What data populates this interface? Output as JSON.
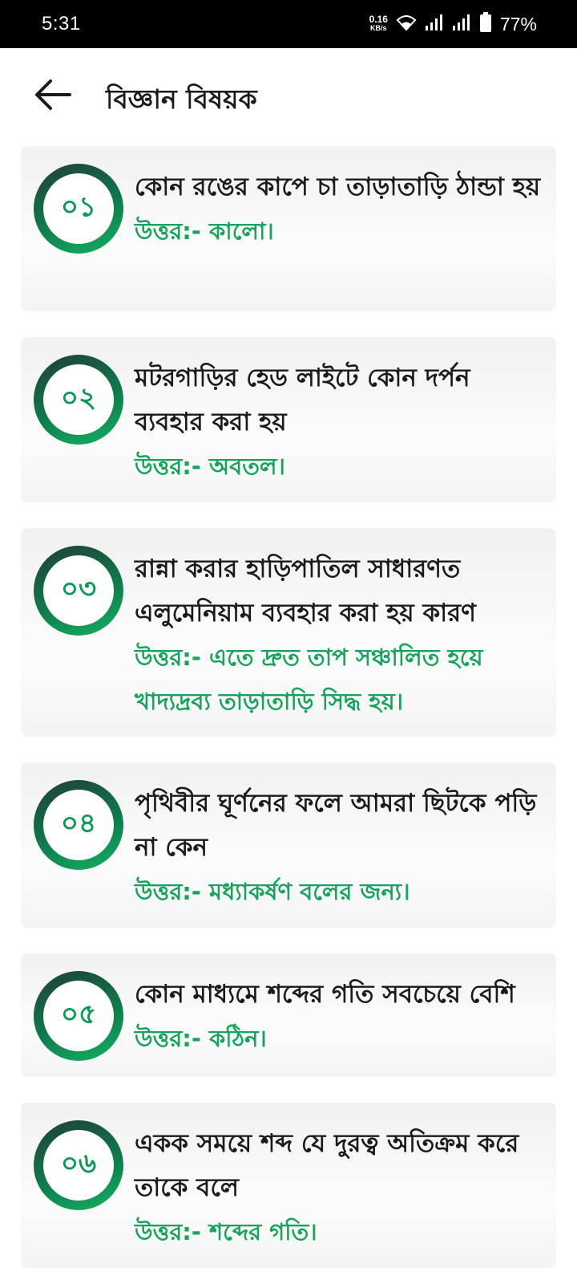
{
  "status_bar": {
    "time": "5:31",
    "net_speed_value": "0.16",
    "net_speed_unit": "KB/s",
    "battery_percent": "77%",
    "icons": [
      "wifi-icon",
      "signal-icon",
      "signal-icon",
      "battery-icon"
    ]
  },
  "header": {
    "back_icon": "arrow-left-icon",
    "title": "বিজ্ঞান বিষয়ক"
  },
  "colors": {
    "accent": "#16a35c",
    "circle_dark": "#1f3f35",
    "circle_light": "#14b263"
  },
  "items": [
    {
      "number": "০১",
      "question": "কোন রঙের কাপে চা তাড়াতাড়ি ঠান্ডা হয়",
      "answer": "উত্তর:- কালো।"
    },
    {
      "number": "০২",
      "question": "মটরগাড়ির হেড লাইটে কোন দর্পন ব্যবহার করা হয়",
      "answer": "উত্তর:- অবতল।"
    },
    {
      "number": "০৩",
      "question": "রান্না করার হাড়িপাতিল সাধারণত এলুমেনিয়াম ব্যবহার করা হয় কারণ",
      "answer": "উত্তর:- এতে দ্রুত তাপ সঞ্চালিত হয়ে খাদ্যদ্রব্য তাড়াতাড়ি সিদ্ধ হয়।"
    },
    {
      "number": "০৪",
      "question": "পৃথিবীর ঘূর্ণনের ফলে আমরা ছিটকে পড়ি না কেন",
      "answer": "উত্তর:- মধ্যাকর্ষণ বলের জন্য।"
    },
    {
      "number": "০৫",
      "question": "কোন মাধ্যমে শব্দের গতি সবচেয়ে বেশি",
      "answer": "উত্তর:- কঠিন।"
    },
    {
      "number": "০৬",
      "question": "একক সময়ে শব্দ যে দুরত্ব অতিক্রম করে তাকে বলে",
      "answer": "উত্তর:- শব্দের গতি।"
    }
  ]
}
